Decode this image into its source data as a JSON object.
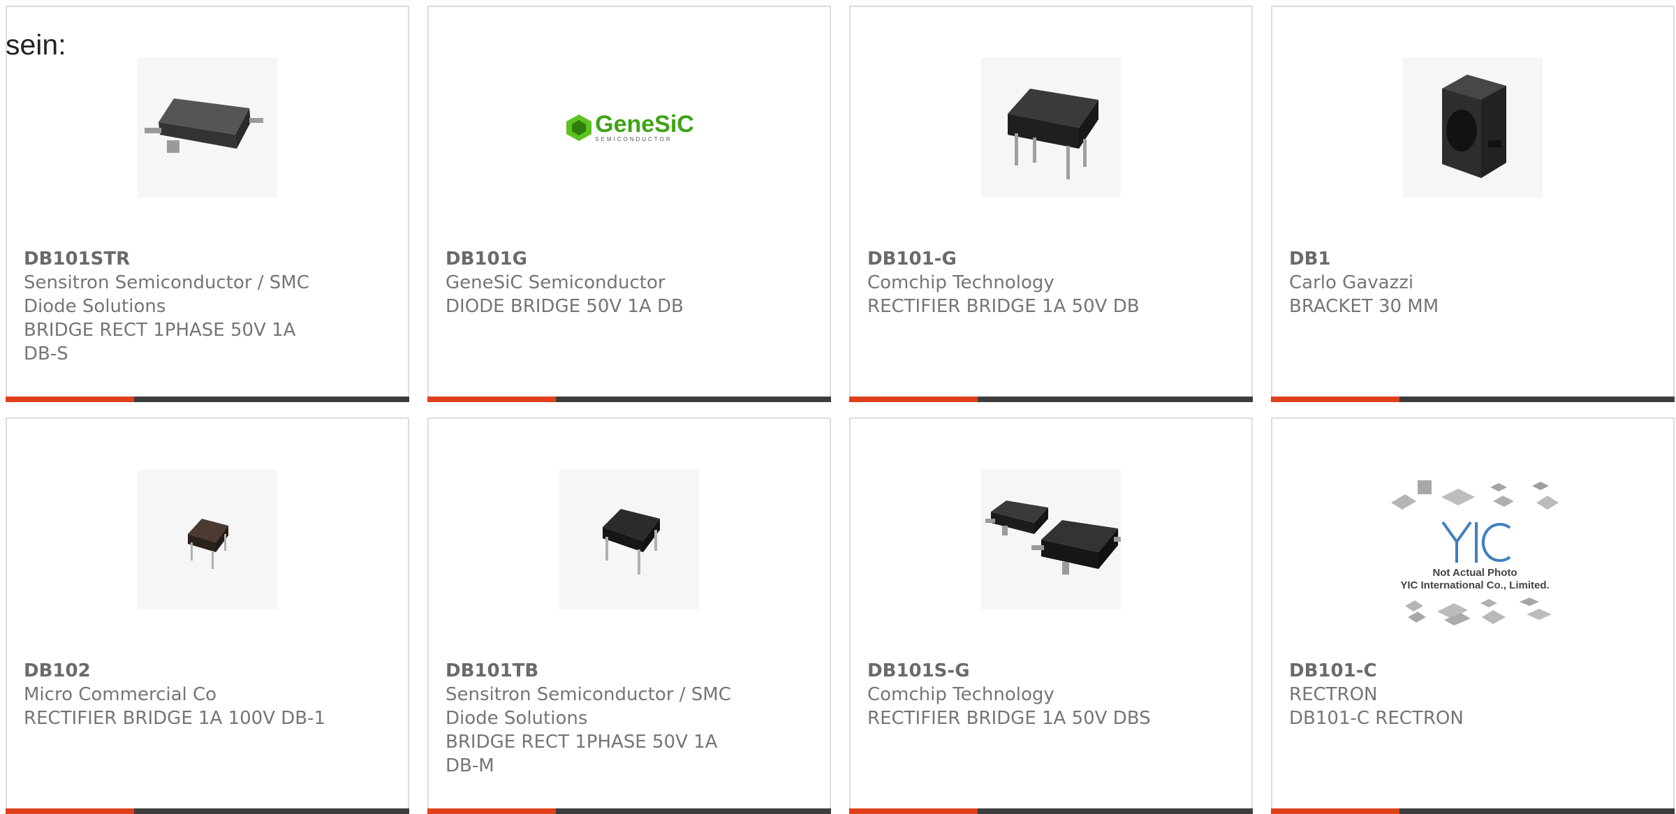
{
  "lead_text": "sein:",
  "colors": {
    "accent": "#e0401b",
    "bar": "#3d3d3d",
    "text": "#757575",
    "border": "#dcdcdc"
  },
  "products": [
    {
      "part_number": "DB101STR",
      "manufacturer": "Sensitron Semiconductor / SMC Diode Solutions",
      "description": "BRIDGE RECT 1PHASE 50V 1A DB-S",
      "image": "smd-bridge-icon"
    },
    {
      "part_number": "DB101G",
      "manufacturer": "GeneSiC Semiconductor",
      "description": "DIODE BRIDGE 50V 1A DB",
      "image": "genesic-logo",
      "logo_text": "GeneSiC",
      "logo_subtext": "SEMICONDUCTOR"
    },
    {
      "part_number": "DB101-G",
      "manufacturer": "Comchip Technology",
      "description": "RECTIFIER BRIDGE 1A 50V DB",
      "image": "dip-bridge-icon"
    },
    {
      "part_number": "DB1",
      "manufacturer": "Carlo Gavazzi",
      "description": "BRACKET 30 MM",
      "image": "bracket-icon"
    },
    {
      "part_number": "DB102",
      "manufacturer": "Micro Commercial Co",
      "description": "RECTIFIER BRIDGE 1A 100V DB-1",
      "image": "small-dip-bridge-icon"
    },
    {
      "part_number": "DB101TB",
      "manufacturer": "Sensitron Semiconductor / SMC Diode Solutions",
      "description": "BRIDGE RECT 1PHASE 50V 1A DB-M",
      "image": "dip-bridge-icon"
    },
    {
      "part_number": "DB101S-G",
      "manufacturer": "Comchip Technology",
      "description": "RECTIFIER BRIDGE 1A 50V DBS",
      "image": "smd-bridge-pair-icon"
    },
    {
      "part_number": "DB101-C",
      "manufacturer": "RECTRON",
      "description": "DB101-C RECTRON",
      "image": "yic-placeholder",
      "photo_note_1": "Not Actual Photo",
      "photo_note_2": "YIC International Co., Limited."
    }
  ]
}
